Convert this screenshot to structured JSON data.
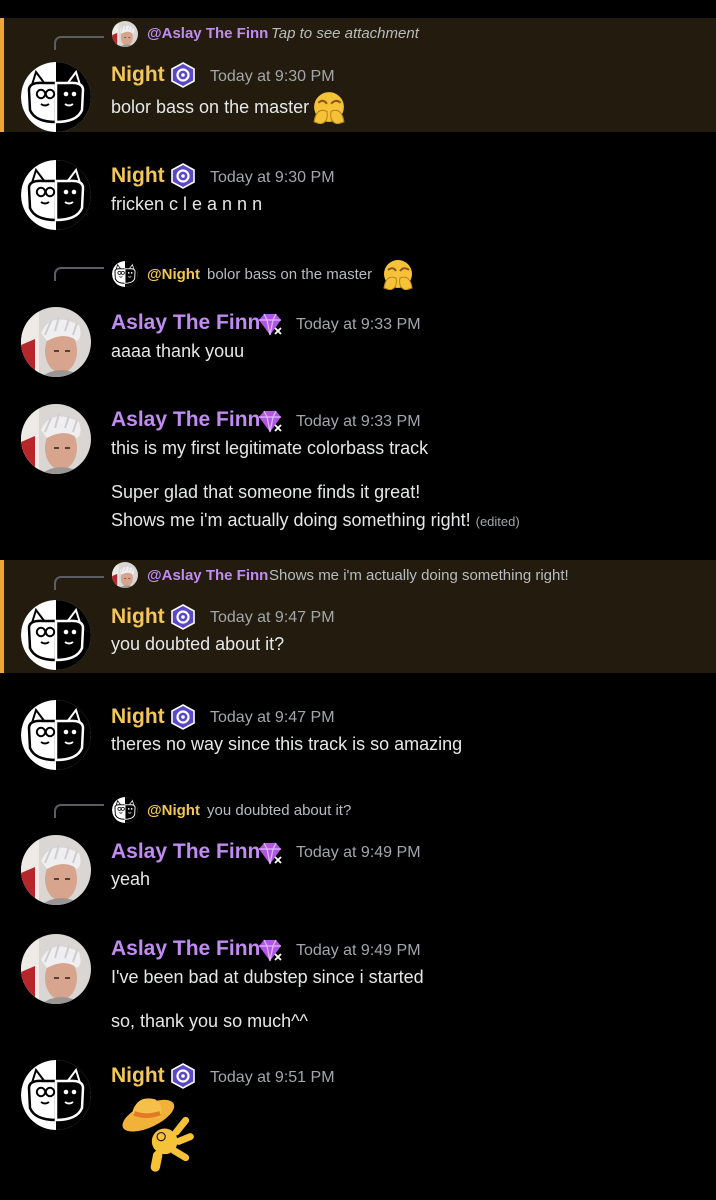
{
  "users": {
    "night": {
      "name": "Night",
      "color": "#f3c65a",
      "mention": "@Night"
    },
    "aslay": {
      "name": "Aslay The Finn",
      "color": "#c08cf2",
      "mention": "@Aslay The Finn"
    }
  },
  "icons": {
    "night_badge": "hexagon-badge-icon",
    "aslay_badge": "nitro-gem-icon",
    "emoji_sweat": "sweating-face-emoji",
    "emoji_hat": "cowboy-hat-ok-emoji"
  },
  "messages": [
    {
      "reply_mention": "@Aslay The Finn",
      "reply_text": "Tap to see attachment",
      "author": "Night",
      "time": "Today at 9:30 PM",
      "lines": [
        "bolor bass on the master"
      ]
    },
    {
      "author": "Night",
      "time": "Today at 9:30 PM",
      "lines": [
        "fricken c l e a n n n"
      ]
    },
    {
      "reply_mention": "@Night",
      "reply_text": "bolor bass on the master",
      "author": "Aslay The Finn",
      "time": "Today at 9:33 PM",
      "lines": [
        "aaaa thank youu"
      ]
    },
    {
      "author": "Aslay The Finn",
      "time": "Today at 9:33 PM",
      "lines": [
        "this is my first legitimate colorbass track",
        "Super glad that someone finds it great!",
        "Shows me i'm actually doing something right!"
      ],
      "edited": "(edited)"
    },
    {
      "reply_mention": "@Aslay The Finn",
      "reply_text": "Shows me i'm actually doing something right!",
      "author": "Night",
      "time": "Today at 9:47 PM",
      "lines": [
        "you doubted about it?"
      ]
    },
    {
      "author": "Night",
      "time": "Today at 9:47 PM",
      "lines": [
        "theres no way since this track is so amazing"
      ]
    },
    {
      "reply_mention": "@Night",
      "reply_text": "you doubted about it?",
      "author": "Aslay The Finn",
      "time": "Today at 9:49 PM",
      "lines": [
        "yeah"
      ]
    },
    {
      "author": "Aslay The Finn",
      "time": "Today at 9:49 PM",
      "lines": [
        "I've been bad at dubstep since i started",
        "so, thank you so much^^"
      ]
    },
    {
      "author": "Night",
      "time": "Today at 9:51 PM",
      "lines": []
    }
  ]
}
